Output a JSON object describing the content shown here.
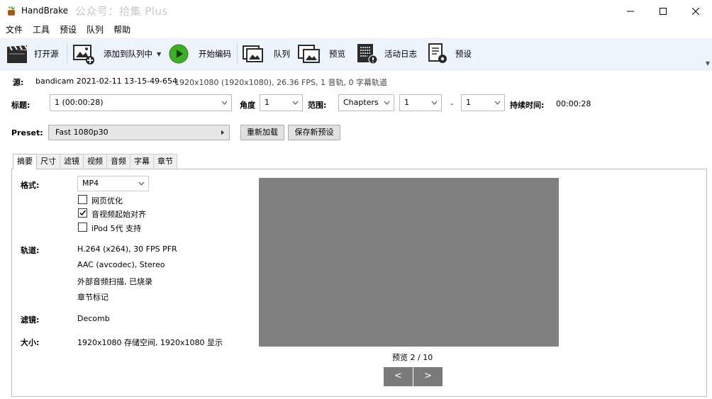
{
  "window": {
    "title": "HandBrake",
    "watermark": "公众号：拾集 Plus"
  },
  "menu": [
    "文件",
    "工具",
    "预设",
    "队列",
    "帮助"
  ],
  "toolbar": {
    "open_source": "打开源",
    "add_to_queue": "添加到队列中",
    "start_encode": "开始编码",
    "queue": "队列",
    "preview": "预览",
    "activity_log": "活动日志",
    "presets": "预设"
  },
  "source": {
    "label": "源:",
    "name": "bandicam 2021-02-11 13-15-49-654",
    "info": "1920x1080 (1920x1080), 26.36 FPS, 1 音轨, 0 字幕轨道"
  },
  "title_row": {
    "title_label": "标题:",
    "title_value": "1  (00:00:28)",
    "angle_label": "角度",
    "angle_value": "1",
    "range_label": "范围:",
    "range_type": "Chapters",
    "range_start": "1",
    "range_dash": "-",
    "range_end": "1",
    "duration_label": "持续时间:",
    "duration_value": "00:00:28"
  },
  "preset_row": {
    "label": "Preset:",
    "value": "Fast 1080p30",
    "reload": "重新加载",
    "save_new": "保存新预设"
  },
  "tabs": [
    "摘要",
    "尺寸",
    "滤镜",
    "视频",
    "音频",
    "字幕",
    "章节"
  ],
  "summary": {
    "format_label": "格式:",
    "format_value": "MP4",
    "opt_web": "网页优化",
    "opt_align": "音视频起始对齐",
    "opt_ipod": "iPod 5代 支持",
    "opt_web_checked": false,
    "opt_align_checked": true,
    "opt_ipod_checked": false,
    "tracks_label": "轨道:",
    "tracks": [
      "H.264 (x264), 30 FPS PFR",
      "AAC (avcodec), Stereo",
      "外部音频扫描, 已烧录",
      "章节标记"
    ],
    "filters_label": "滤镜:",
    "filters_value": "Decomb",
    "size_label": "大小:",
    "size_value": "1920x1080 存储空间, 1920x1080 显示",
    "preview_counter": "预览 2 / 10",
    "prev_btn": "<",
    "next_btn": ">"
  },
  "colors": {
    "toolbar_bg": "#eef4fb",
    "preview_gray": "#808080",
    "play_green": "#3fae2a"
  }
}
